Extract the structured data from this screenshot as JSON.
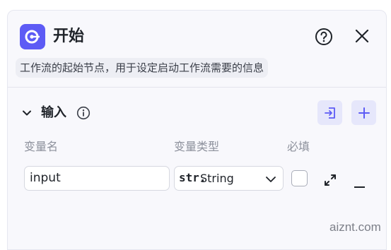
{
  "header": {
    "title": "开始",
    "icon": "start-node-icon",
    "brand_color": "#5d5bf5"
  },
  "description": "工作流的起始节点，用于设定启动工作流需要的信息",
  "input_section": {
    "title": "输入",
    "columns": {
      "name": "变量名",
      "type": "变量类型",
      "required": "必填"
    },
    "rows": [
      {
        "name": "input",
        "type_prefix": "str.",
        "type": "String",
        "required": false
      }
    ]
  },
  "watermark": "aiznt.com"
}
